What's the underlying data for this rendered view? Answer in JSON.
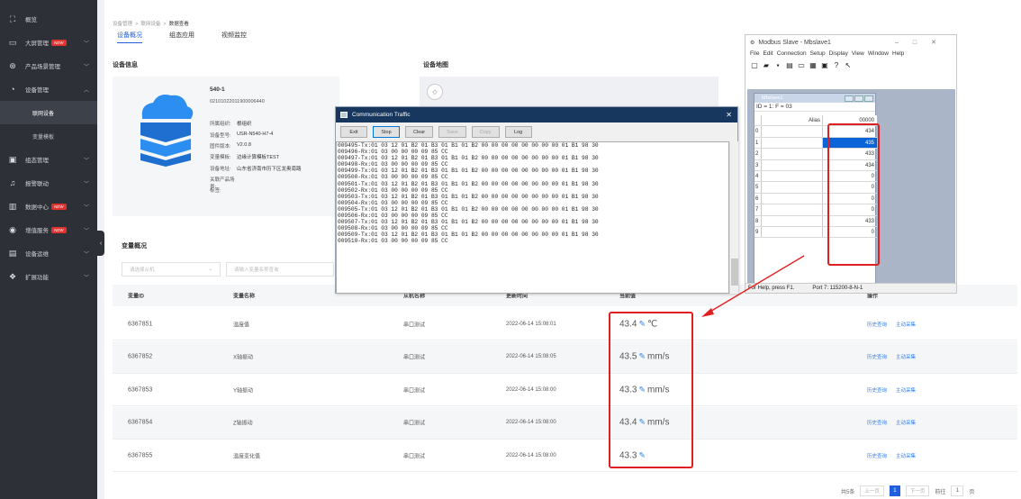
{
  "sidebar": {
    "items": [
      {
        "label": "概览",
        "icon": "⛶",
        "has_chev": false,
        "badge": ""
      },
      {
        "label": "大屏管理",
        "icon": "▭",
        "has_chev": true,
        "badge": "NEW"
      },
      {
        "label": "产品场景管理",
        "icon": "⊛",
        "has_chev": true,
        "badge": ""
      },
      {
        "label": "设备管理",
        "icon": "◔",
        "has_chev": true,
        "badge": "",
        "expanded": true
      },
      {
        "label": "联网设备",
        "sub": true,
        "active": true
      },
      {
        "label": "变量模板",
        "sub": true
      },
      {
        "label": "组态管理",
        "icon": "▣",
        "has_chev": true,
        "badge": ""
      },
      {
        "label": "报警联动",
        "icon": "♫",
        "has_chev": true,
        "badge": ""
      },
      {
        "label": "数据中心",
        "icon": "▥",
        "has_chev": true,
        "badge": "NEW"
      },
      {
        "label": "增值服务",
        "icon": "◉",
        "has_chev": true,
        "badge": "NEW"
      },
      {
        "label": "设备运维",
        "icon": "▤",
        "has_chev": true,
        "badge": ""
      },
      {
        "label": "扩展功能",
        "icon": "❖",
        "has_chev": true,
        "badge": ""
      }
    ]
  },
  "breadcrumb": [
    "设备管理",
    "联网设备",
    "数据查看"
  ],
  "tabs": [
    "设备概况",
    "组态应用",
    "视频监控"
  ],
  "device_info_title": "设备信息",
  "device_map_title": "设备地图",
  "device": {
    "name": "540-1",
    "sn": "02101022011900006440",
    "fields": [
      {
        "k": "所属组织:",
        "v": "根组织"
      },
      {
        "k": "设备型号:",
        "v": "USR-N540-H7-4"
      },
      {
        "k": "固件版本:",
        "v": "V2.0.8"
      },
      {
        "k": "变量模板:",
        "v": "边缘计算模板TEST"
      },
      {
        "k": "设备地址:",
        "v": "山东省济南市历下区龙奥南路"
      },
      {
        "k": "关联产品场景:",
        "v": ""
      },
      {
        "k": "标签:",
        "v": ""
      }
    ]
  },
  "variables_title": "变量概况",
  "filters": {
    "slave_placeholder": "请选择从机",
    "name_placeholder": "请输入变量名称查询"
  },
  "table": {
    "headers": [
      "变量ID",
      "变量名称",
      "从机名称",
      "更新时间",
      "当前值",
      "操作"
    ],
    "rows": [
      {
        "id": "6367851",
        "name": "温度值",
        "slave": "串口测试",
        "time": "2022-06-14 15:08:01",
        "value": "43.4",
        "unit": "℃"
      },
      {
        "id": "6367852",
        "name": "X轴振动",
        "slave": "串口测试",
        "time": "2022-06-14 15:08:05",
        "value": "43.5",
        "unit": "mm/s"
      },
      {
        "id": "6367853",
        "name": "Y轴振动",
        "slave": "串口测试",
        "time": "2022-06-14 15:08:00",
        "value": "43.3",
        "unit": "mm/s"
      },
      {
        "id": "6367854",
        "name": "Z轴振动",
        "slave": "串口测试",
        "time": "2022-06-14 15:08:00",
        "value": "43.4",
        "unit": "mm/s"
      },
      {
        "id": "6367855",
        "name": "温度变化值",
        "slave": "串口测试",
        "time": "2022-06-14 15:08:00",
        "value": "43.3",
        "unit": ""
      }
    ],
    "actions": [
      "历史查询",
      "主动采集"
    ]
  },
  "pager": {
    "total": "共5条",
    "prev": "上一页",
    "page": "1",
    "next": "下一页",
    "goto": "前往",
    "goto_val": "1",
    "page_unit": "页"
  },
  "comm": {
    "title": "Communication Traffic",
    "buttons": [
      "Exit",
      "Stop",
      "Clear",
      "Save",
      "Copy",
      "Log"
    ],
    "lines": [
      "009495-Tx:01 03 12 01 B2 01 B3 01 B1 01 B2 00 00 00 00 00 00 00 00 01 B1 98 30",
      "009496-Rx:01 03 00 00 00 09 85 CC",
      "009497-Tx:01 03 12 01 B2 01 B3 01 B1 01 B2 00 00 00 00 00 00 00 00 01 B1 98 30",
      "009498-Rx:01 03 00 00 00 09 85 CC",
      "009499-Tx:01 03 12 01 B2 01 B3 01 B1 01 B2 00 00 00 00 00 00 00 00 01 B1 98 30",
      "009500-Rx:01 03 00 00 00 09 85 CC",
      "009501-Tx:01 03 12 01 B2 01 B3 01 B1 01 B2 00 00 00 00 00 00 00 00 01 B1 98 30",
      "009502-Rx:01 03 00 00 00 09 85 CC",
      "009503-Tx:01 03 12 01 B2 01 B3 01 B1 01 B2 00 00 00 00 00 00 00 00 01 B1 98 30",
      "009504-Rx:01 03 00 00 00 09 85 CC",
      "009505-Tx:01 03 12 01 B2 01 B3 01 B1 01 B2 00 00 00 00 00 00 00 00 01 B1 98 30",
      "009506-Rx:01 03 00 00 00 09 85 CC",
      "009507-Tx:01 03 12 01 B2 01 B3 01 B1 01 B2 00 00 00 00 00 00 00 00 01 B1 98 30",
      "009508-Rx:01 03 00 00 00 09 85 CC",
      "009509-Tx:01 03 12 01 B2 01 B3 01 B1 01 B2 00 00 00 00 00 00 00 00 01 B1 98 30",
      "009510-Rx:01 03 00 00 00 09 85 CC"
    ]
  },
  "modbus": {
    "title": "Modbus Slave - Mbslave1",
    "menu": [
      "File",
      "Edit",
      "Connection",
      "Setup",
      "Display",
      "View",
      "Window",
      "Help"
    ],
    "child_title": "Mbslave1",
    "id_line": "ID = 1: F = 03",
    "alias_header": "Alias",
    "col_header": "00000",
    "rows": [
      {
        "i": "0",
        "v": "434"
      },
      {
        "i": "1",
        "v": "435",
        "sel": true
      },
      {
        "i": "2",
        "v": "433"
      },
      {
        "i": "3",
        "v": "434"
      },
      {
        "i": "4",
        "v": "0"
      },
      {
        "i": "5",
        "v": "0"
      },
      {
        "i": "6",
        "v": "0"
      },
      {
        "i": "7",
        "v": "0"
      },
      {
        "i": "8",
        "v": "433"
      },
      {
        "i": "9",
        "v": "0"
      }
    ],
    "status_left": "For Help, press F1.",
    "status_right": "Port 7: 115200-8-N-1"
  },
  "colors": {
    "accent": "#1f5fde",
    "annotation": "#e02020",
    "sidebar": "#2d3037"
  }
}
